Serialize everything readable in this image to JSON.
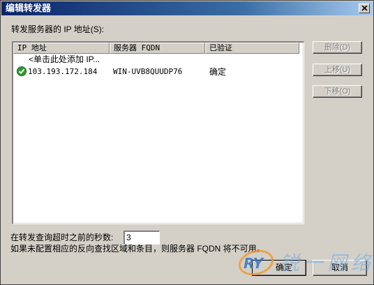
{
  "window": {
    "title": "编辑转发器",
    "close_icon": "close-icon"
  },
  "section_label": "转发服务器的 IP 地址(S):",
  "listview": {
    "columns": [
      "IP 地址",
      "服务器 FQDN",
      "已验证"
    ],
    "add_row_text": "<单击此处添加 IP...",
    "rows": [
      {
        "status_icon": "check-icon",
        "ip": "103.193.172.184",
        "fqdn": "WIN-UVB8QUUDP76",
        "validated": "确定"
      }
    ]
  },
  "side_buttons": {
    "delete": "删除(D)",
    "move_up": "上移(U)",
    "move_down": "下移(O)"
  },
  "timeout": {
    "label": "在转发查询超时之前的秒数:",
    "value": "3"
  },
  "note": "如果未配置相应的反向查找区域和条目，则服务器 FQDN 将不可用。",
  "buttons": {
    "ok": "确定",
    "cancel": "取消"
  },
  "watermark": {
    "logo_letters": "RY",
    "text": "锐一网络"
  },
  "colors": {
    "title_start": "#0a246a",
    "title_end": "#a6caf0",
    "dialog_bg": "#d4d0c8",
    "check_green": "#2e9a2e"
  }
}
